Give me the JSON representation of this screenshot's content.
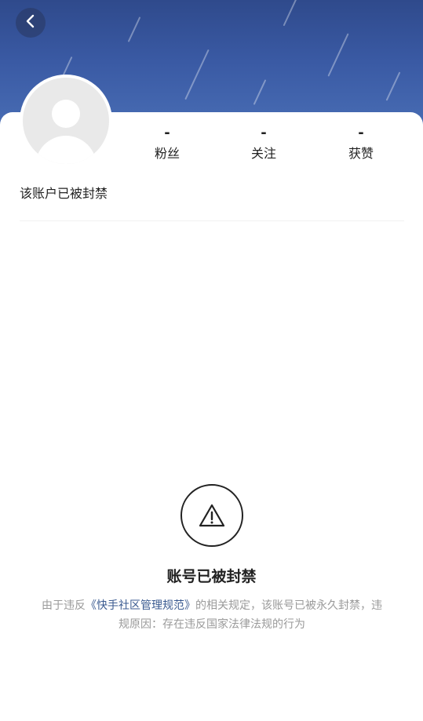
{
  "header": {
    "back_icon": "chevron-left-icon",
    "background_color": "#3a5aa4"
  },
  "profile": {
    "avatar_icon": "default-avatar-icon",
    "status_text": "该账户已被封禁",
    "stats": [
      {
        "value": "-",
        "label": "粉丝"
      },
      {
        "value": "-",
        "label": "关注"
      },
      {
        "value": "-",
        "label": "获赞"
      }
    ]
  },
  "ban_notice": {
    "icon": "warning-icon",
    "title": "账号已被封禁",
    "desc_before": "由于违反",
    "desc_link": "《快手社区管理规范》",
    "desc_after": "的相关规定，该账号已被永久封禁，违规原因：存在违反国家法律法规的行为",
    "link_color": "#3a5a90"
  }
}
